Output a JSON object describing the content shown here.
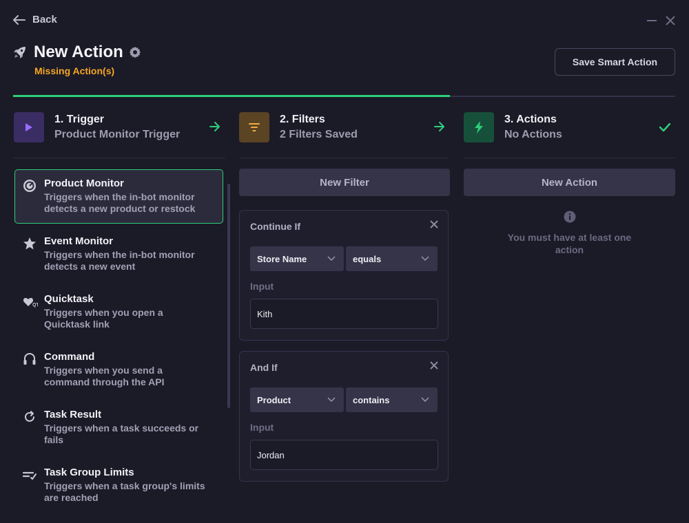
{
  "nav": {
    "back_label": "Back"
  },
  "header": {
    "title": "New Action",
    "status": "Missing Action(s)",
    "save_label": "Save Smart Action"
  },
  "progress": {
    "fraction": 0.66
  },
  "steps": [
    {
      "title": "1. Trigger",
      "subtitle": "Product Monitor Trigger",
      "icon": "play-icon",
      "color": "#3f2f6e",
      "icon_color": "#9b6cff"
    },
    {
      "title": "2. Filters",
      "subtitle": "2 Filters Saved",
      "icon": "filter-icon",
      "color": "#5a4424",
      "icon_color": "#f0b040"
    },
    {
      "title": "3. Actions",
      "subtitle": "No Actions",
      "icon": "bolt-icon",
      "color": "#17503a",
      "icon_color": "#2ecf7a"
    }
  ],
  "triggers": [
    {
      "name": "Product Monitor",
      "desc1": "Triggers when the in-bot monitor",
      "desc2": "detects a new product or restock",
      "icon": "monitor-icon",
      "active": true
    },
    {
      "name": "Event Monitor",
      "desc1": "Triggers when the in-bot monitor",
      "desc2": "detects a new event",
      "icon": "star-icon"
    },
    {
      "name": "Quicktask",
      "desc1": "Triggers when you open a",
      "desc2": "Quicktask link",
      "icon": "quicktask-icon"
    },
    {
      "name": "Command",
      "desc1": "Triggers when you send a",
      "desc2": "command through the API",
      "icon": "headset-icon"
    },
    {
      "name": "Task Result",
      "desc1": "Triggers when a task succeeds or",
      "desc2": "fails",
      "icon": "refresh-icon"
    },
    {
      "name": "Task Group Limits",
      "desc1": "Triggers when a task group's limits",
      "desc2": "are reached",
      "icon": "limits-icon"
    }
  ],
  "filters": {
    "new_label": "New Filter",
    "input_label": "Input",
    "cards": [
      {
        "title": "Continue If",
        "field": "Store Name",
        "operator": "equals",
        "value": "Kith"
      },
      {
        "title": "And If",
        "field": "Product",
        "operator": "contains",
        "value": "Jordan"
      }
    ]
  },
  "actions": {
    "new_label": "New Action",
    "empty_text": "You must have at least one action"
  },
  "colors": {
    "accent": "#2ecf7a",
    "warning": "#f5a623",
    "background": "#1b1a27"
  }
}
